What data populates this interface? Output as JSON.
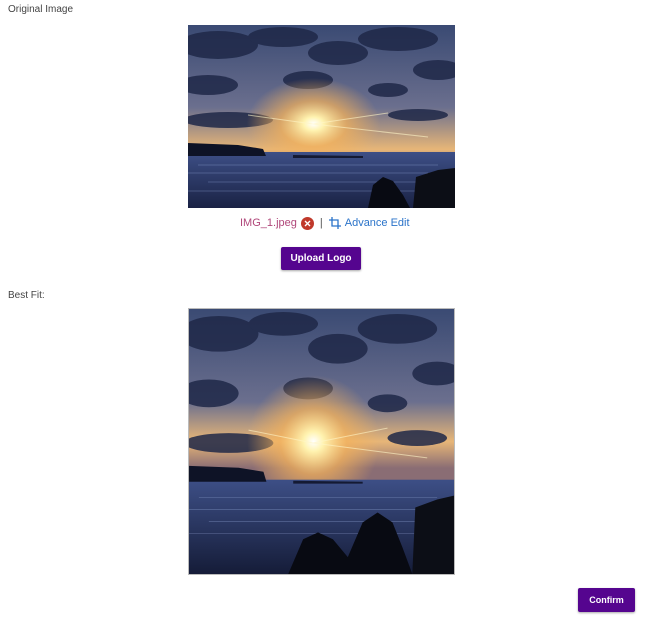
{
  "sections": {
    "original_label": "Original Image",
    "best_fit_label": "Best Fit:"
  },
  "file": {
    "name": "IMG_1.jpeg",
    "separator": "|",
    "advance_edit_label": "Advance Edit"
  },
  "buttons": {
    "upload_logo": "Upload Logo",
    "confirm": "Confirm"
  },
  "icons": {
    "remove": "close-circle-icon",
    "crop": "crop-icon"
  },
  "colors": {
    "primary": "#55058f",
    "file_name": "#b0477a",
    "link": "#2a73c9",
    "remove": "#c0392b"
  }
}
